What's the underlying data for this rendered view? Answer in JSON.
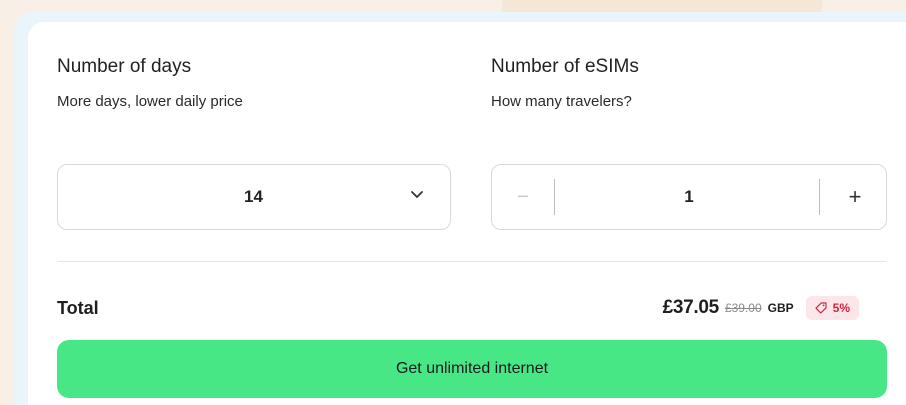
{
  "days": {
    "title": "Number of days",
    "subtitle": "More days, lower daily price",
    "selected": "14"
  },
  "esims": {
    "title": "Number of eSIMs",
    "subtitle": "How many travelers?",
    "value": "1",
    "decrement_label": "−",
    "increment_label": "+"
  },
  "total": {
    "label": "Total",
    "price": "£37.05",
    "original_price": "£39.00",
    "currency": "GBP",
    "discount": "5%"
  },
  "cta": {
    "label": "Get unlimited internet"
  },
  "colors": {
    "cta": "#46e784",
    "discount_bg": "#fde6ea",
    "discount_text": "#d1243f"
  }
}
